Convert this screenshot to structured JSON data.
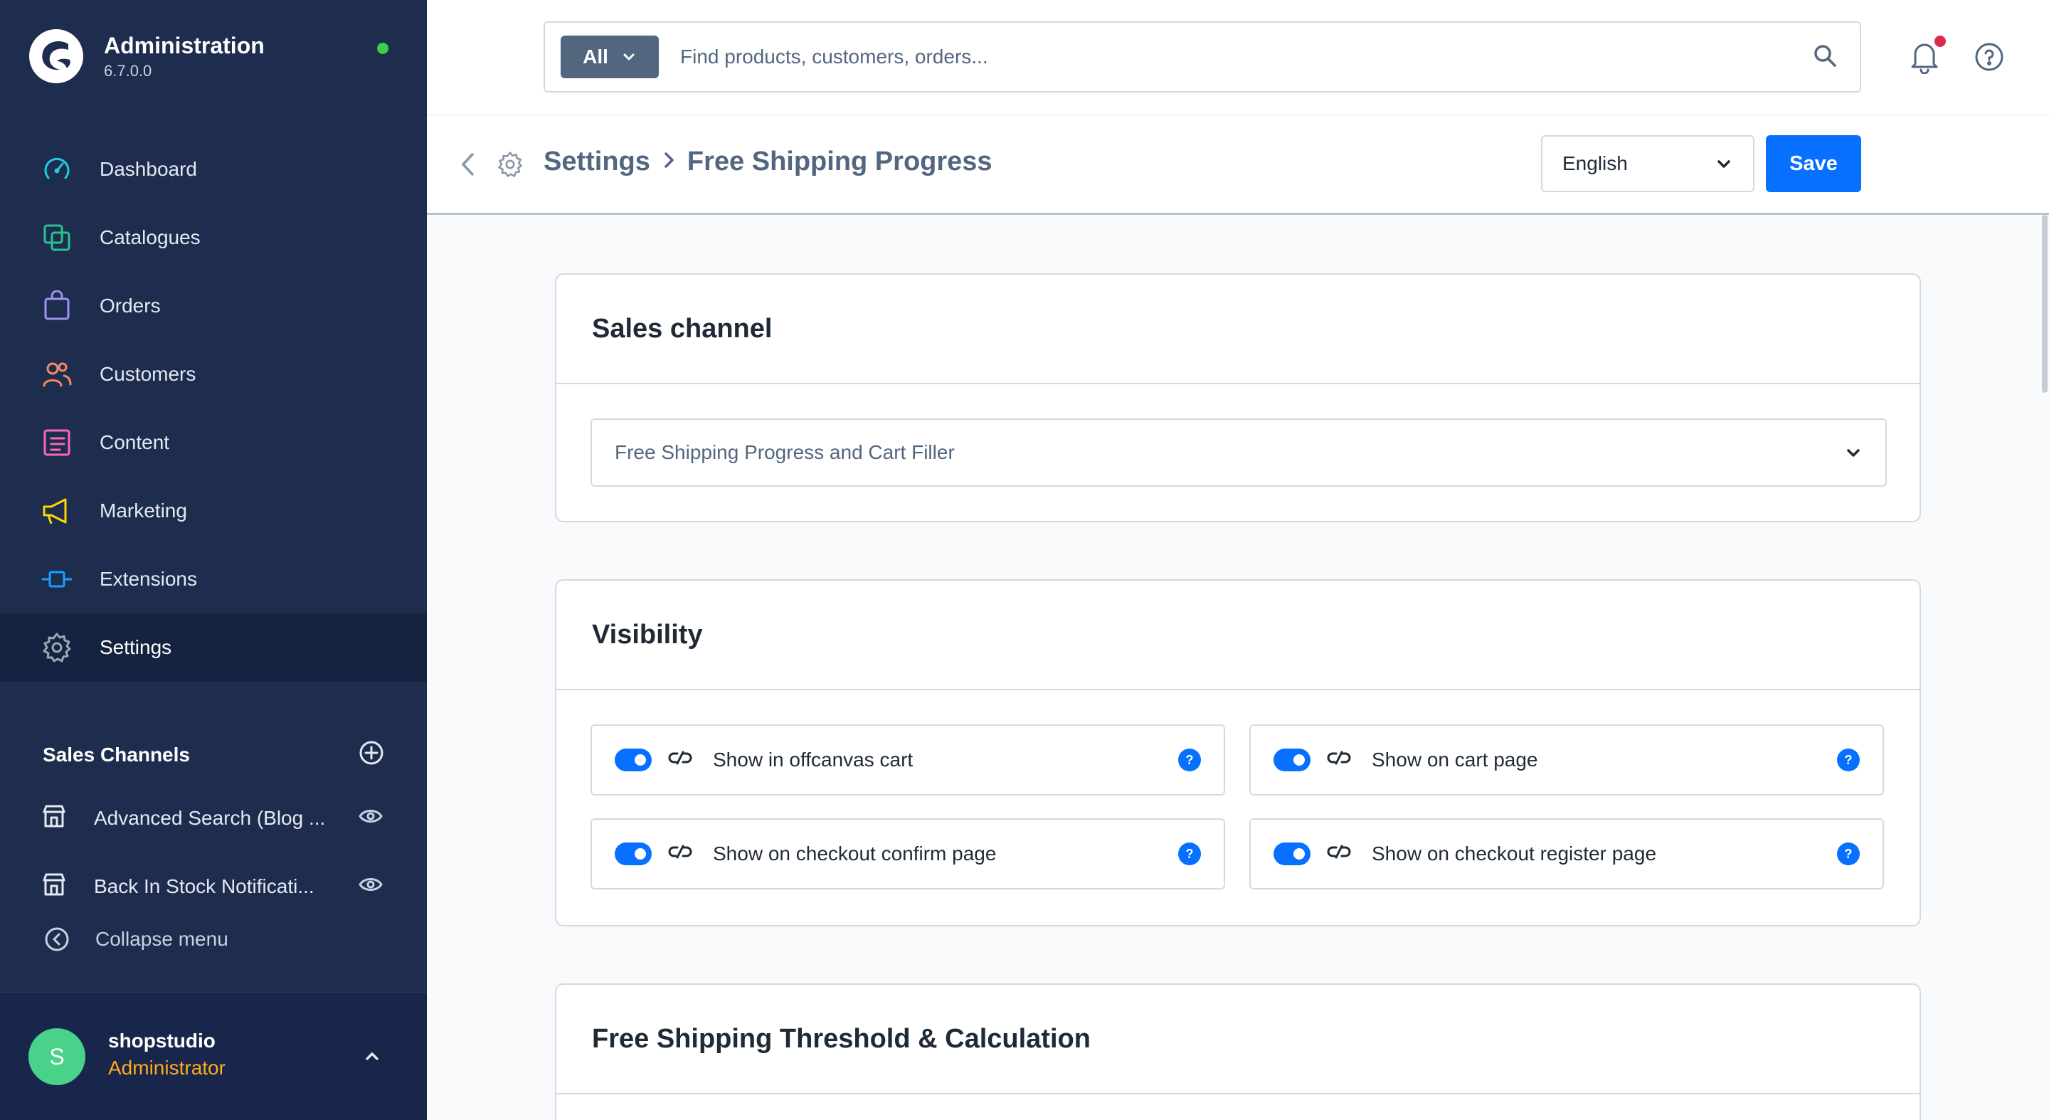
{
  "app": {
    "title": "Administration",
    "version": "6.7.0.0"
  },
  "nav": {
    "items": [
      {
        "label": "Dashboard",
        "icon": "dashboard-icon",
        "color": "#1fcbe0"
      },
      {
        "label": "Catalogues",
        "icon": "catalogues-icon",
        "color": "#2ac38e"
      },
      {
        "label": "Orders",
        "icon": "orders-icon",
        "color": "#a092f0"
      },
      {
        "label": "Customers",
        "icon": "customers-icon",
        "color": "#f88962"
      },
      {
        "label": "Content",
        "icon": "content-icon",
        "color": "#ff68b4"
      },
      {
        "label": "Marketing",
        "icon": "marketing-icon",
        "color": "#ffd700"
      },
      {
        "label": "Extensions",
        "icon": "extensions-icon",
        "color": "#189eff"
      },
      {
        "label": "Settings",
        "icon": "settings-icon",
        "color": "#9aa8b5",
        "active": true
      }
    ]
  },
  "sales_channels": {
    "title": "Sales Channels",
    "items": [
      {
        "label": "Advanced Search (Blog ..."
      },
      {
        "label": "Back In Stock Notificati..."
      }
    ],
    "collapse_label": "Collapse menu"
  },
  "user": {
    "initial": "S",
    "name": "shopstudio",
    "role": "Administrator"
  },
  "search": {
    "type_label": "All",
    "placeholder": "Find products, customers, orders..."
  },
  "page": {
    "breadcrumb_parent": "Settings",
    "breadcrumb_current": "Free Shipping Progress",
    "language": "English",
    "save_label": "Save"
  },
  "cards": {
    "sales_channel": {
      "title": "Sales channel",
      "selected": "Free Shipping Progress and Cart Filler"
    },
    "visibility": {
      "title": "Visibility",
      "toggles": [
        {
          "label": "Show in offcanvas cart",
          "enabled": true
        },
        {
          "label": "Show on cart page",
          "enabled": true
        },
        {
          "label": "Show on checkout confirm page",
          "enabled": true
        },
        {
          "label": "Show on checkout register page",
          "enabled": true
        }
      ],
      "help_glyph": "?"
    },
    "threshold": {
      "title": "Free Shipping Threshold & Calculation"
    }
  },
  "colors": {
    "sidebar_bg": "#1e2d4e",
    "primary": "#0870ff",
    "online": "#37d046",
    "notification": "#de294c",
    "role": "#ffab1a"
  }
}
